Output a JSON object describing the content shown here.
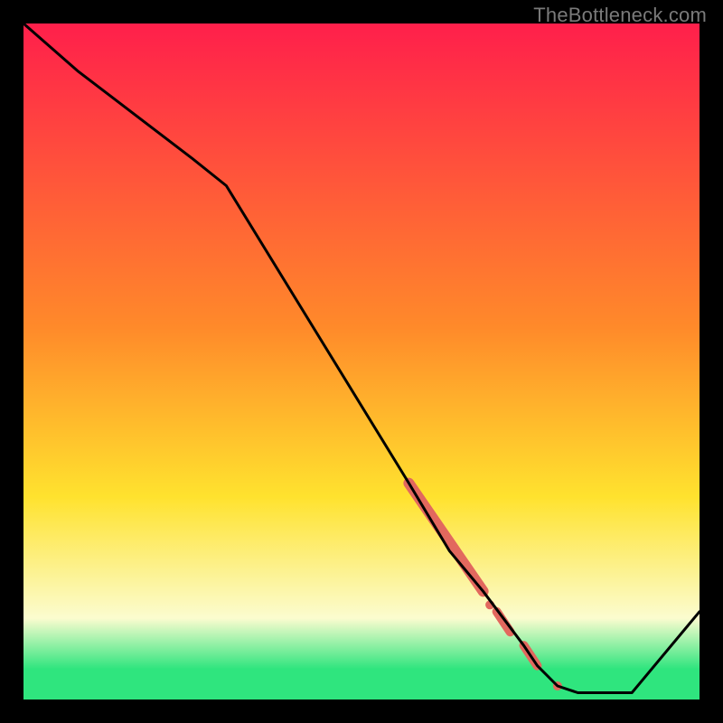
{
  "watermark": "TheBottleneck.com",
  "colors": {
    "frame": "#000000",
    "grad_top": "#ff1f4b",
    "grad_mid1": "#ff8a2a",
    "grad_mid2": "#ffe22e",
    "grad_pale": "#fbfccf",
    "grad_green": "#2fe57e",
    "curve": "#000000",
    "marker": "#e2685e"
  },
  "chart_data": {
    "type": "line",
    "title": "",
    "xlabel": "",
    "ylabel": "",
    "xlim": [
      0,
      100
    ],
    "ylim": [
      0,
      100
    ],
    "x": [
      0,
      8,
      25,
      30,
      57,
      63,
      68,
      74,
      76,
      79,
      82,
      90,
      100
    ],
    "values": [
      100,
      93,
      80,
      76,
      32,
      22,
      16,
      8,
      5,
      2,
      1,
      1,
      13
    ],
    "highlight_segments": [
      {
        "x0": 57,
        "y0": 32,
        "x1": 68,
        "y1": 16,
        "w": 12
      },
      {
        "x0": 70,
        "y0": 13,
        "x1": 72,
        "y1": 10,
        "w": 10
      },
      {
        "x0": 74,
        "y0": 8,
        "x1": 76,
        "y1": 5,
        "w": 10
      }
    ],
    "highlight_dots": [
      {
        "x": 69,
        "y": 14,
        "r": 5
      },
      {
        "x": 79,
        "y": 2,
        "r": 5
      }
    ],
    "gradient_stops": [
      {
        "pct": 0,
        "key": "grad_top"
      },
      {
        "pct": 45,
        "key": "grad_mid1"
      },
      {
        "pct": 70,
        "key": "grad_mid2"
      },
      {
        "pct": 88,
        "key": "grad_pale"
      },
      {
        "pct": 95.5,
        "key": "grad_green"
      },
      {
        "pct": 100,
        "key": "grad_green"
      }
    ]
  }
}
